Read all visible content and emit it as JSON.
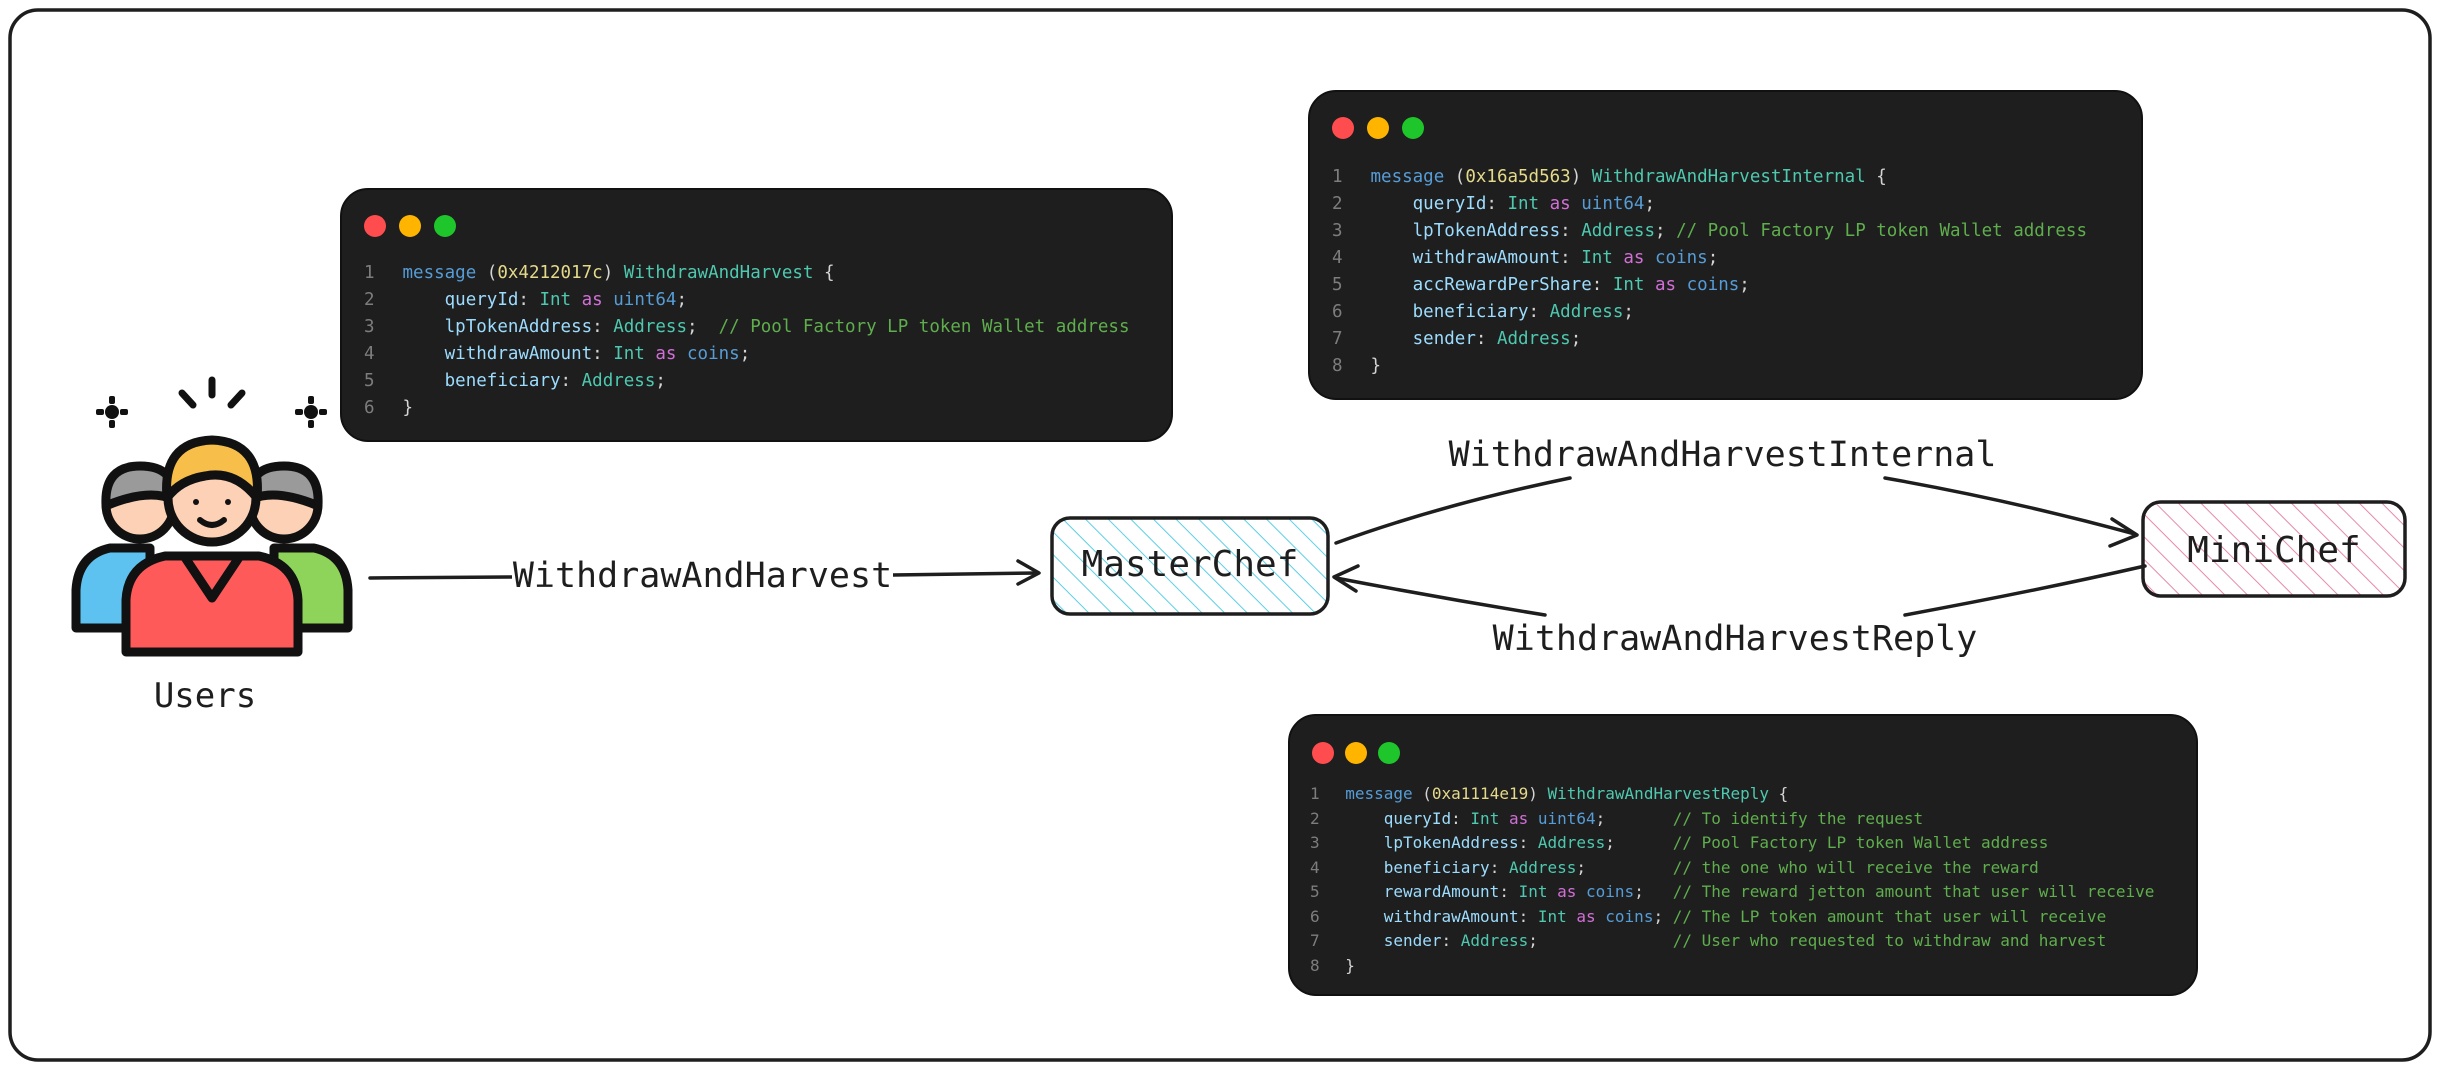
{
  "nodes": {
    "users": "Users",
    "masterchef": "MasterChef",
    "minichef": "MiniChef"
  },
  "edges": {
    "withdraw_and_harvest": "WithdrawAndHarvest",
    "withdraw_and_harvest_internal": "WithdrawAndHarvestInternal",
    "withdraw_and_harvest_reply": "WithdrawAndHarvestReply"
  },
  "colors": {
    "masterchef_hatch": "#5ccfe6",
    "minichef_hatch": "#e88aa8",
    "code_bg": "#1e1e1e"
  },
  "code_blocks": [
    {
      "lines": [
        [
          "1",
          [
            [
              "message",
              "t-kw"
            ],
            [
              " (",
              "t-pun"
            ],
            [
              "0x4212017c",
              "t-num"
            ],
            [
              ") ",
              "t-pun"
            ],
            [
              "WithdrawAndHarvest",
              "t-type"
            ],
            [
              " {",
              "t-pun"
            ]
          ]
        ],
        [
          "2",
          [
            [
              "    queryId",
              "t-field"
            ],
            [
              ": ",
              "t-pun"
            ],
            [
              "Int",
              "t-type"
            ],
            [
              " as ",
              "t-as"
            ],
            [
              "uint64",
              "t-prim"
            ],
            [
              ";",
              "t-pun"
            ]
          ]
        ],
        [
          "3",
          [
            [
              "    lpTokenAddress",
              "t-field"
            ],
            [
              ": ",
              "t-pun"
            ],
            [
              "Address",
              "t-type"
            ],
            [
              ";  ",
              "t-pun"
            ],
            [
              "// Pool Factory LP token Wallet address",
              "t-cmt"
            ]
          ]
        ],
        [
          "4",
          [
            [
              "    withdrawAmount",
              "t-field"
            ],
            [
              ": ",
              "t-pun"
            ],
            [
              "Int",
              "t-type"
            ],
            [
              " as ",
              "t-as"
            ],
            [
              "coins",
              "t-prim"
            ],
            [
              ";",
              "t-pun"
            ]
          ]
        ],
        [
          "5",
          [
            [
              "    beneficiary",
              "t-field"
            ],
            [
              ": ",
              "t-pun"
            ],
            [
              "Address",
              "t-type"
            ],
            [
              ";",
              "t-pun"
            ]
          ]
        ],
        [
          "6",
          [
            [
              "}",
              "t-pun"
            ]
          ]
        ]
      ]
    },
    {
      "lines": [
        [
          "1",
          [
            [
              "message",
              "t-kw"
            ],
            [
              " (",
              "t-pun"
            ],
            [
              "0x16a5d563",
              "t-num"
            ],
            [
              ") ",
              "t-pun"
            ],
            [
              "WithdrawAndHarvestInternal",
              "t-type"
            ],
            [
              " {",
              "t-pun"
            ]
          ]
        ],
        [
          "2",
          [
            [
              "    queryId",
              "t-field"
            ],
            [
              ": ",
              "t-pun"
            ],
            [
              "Int",
              "t-type"
            ],
            [
              " as ",
              "t-as"
            ],
            [
              "uint64",
              "t-prim"
            ],
            [
              ";",
              "t-pun"
            ]
          ]
        ],
        [
          "3",
          [
            [
              "    lpTokenAddress",
              "t-field"
            ],
            [
              ": ",
              "t-pun"
            ],
            [
              "Address",
              "t-type"
            ],
            [
              "; ",
              "t-pun"
            ],
            [
              "// Pool Factory LP token Wallet address",
              "t-cmt"
            ]
          ]
        ],
        [
          "4",
          [
            [
              "    withdrawAmount",
              "t-field"
            ],
            [
              ": ",
              "t-pun"
            ],
            [
              "Int",
              "t-type"
            ],
            [
              " as ",
              "t-as"
            ],
            [
              "coins",
              "t-prim"
            ],
            [
              ";",
              "t-pun"
            ]
          ]
        ],
        [
          "5",
          [
            [
              "    accRewardPerShare",
              "t-field"
            ],
            [
              ": ",
              "t-pun"
            ],
            [
              "Int",
              "t-type"
            ],
            [
              " as ",
              "t-as"
            ],
            [
              "coins",
              "t-prim"
            ],
            [
              ";",
              "t-pun"
            ]
          ]
        ],
        [
          "6",
          [
            [
              "    beneficiary",
              "t-field"
            ],
            [
              ": ",
              "t-pun"
            ],
            [
              "Address",
              "t-type"
            ],
            [
              ";",
              "t-pun"
            ]
          ]
        ],
        [
          "7",
          [
            [
              "    sender",
              "t-field"
            ],
            [
              ": ",
              "t-pun"
            ],
            [
              "Address",
              "t-type"
            ],
            [
              ";",
              "t-pun"
            ]
          ]
        ],
        [
          "8",
          [
            [
              "}",
              "t-pun"
            ]
          ]
        ]
      ]
    },
    {
      "lines": [
        [
          "1",
          [
            [
              "message",
              "t-kw"
            ],
            [
              " (",
              "t-pun"
            ],
            [
              "0xa1114e19",
              "t-num"
            ],
            [
              ") ",
              "t-pun"
            ],
            [
              "WithdrawAndHarvestReply",
              "t-type"
            ],
            [
              " {",
              "t-pun"
            ]
          ]
        ],
        [
          "2",
          [
            [
              "    queryId",
              "t-field"
            ],
            [
              ": ",
              "t-pun"
            ],
            [
              "Int",
              "t-type"
            ],
            [
              " as ",
              "t-as"
            ],
            [
              "uint64",
              "t-prim"
            ],
            [
              ";       ",
              "t-pun"
            ],
            [
              "// To identify the request",
              "t-cmt"
            ]
          ]
        ],
        [
          "3",
          [
            [
              "    lpTokenAddress",
              "t-field"
            ],
            [
              ": ",
              "t-pun"
            ],
            [
              "Address",
              "t-type"
            ],
            [
              ";      ",
              "t-pun"
            ],
            [
              "// Pool Factory LP token Wallet address",
              "t-cmt"
            ]
          ]
        ],
        [
          "4",
          [
            [
              "    beneficiary",
              "t-field"
            ],
            [
              ": ",
              "t-pun"
            ],
            [
              "Address",
              "t-type"
            ],
            [
              ";         ",
              "t-pun"
            ],
            [
              "// the one who will receive the reward",
              "t-cmt"
            ]
          ]
        ],
        [
          "5",
          [
            [
              "    rewardAmount",
              "t-field"
            ],
            [
              ": ",
              "t-pun"
            ],
            [
              "Int",
              "t-type"
            ],
            [
              " as ",
              "t-as"
            ],
            [
              "coins",
              "t-prim"
            ],
            [
              ";   ",
              "t-pun"
            ],
            [
              "// The reward jetton amount that user will receive",
              "t-cmt"
            ]
          ]
        ],
        [
          "6",
          [
            [
              "    withdrawAmount",
              "t-field"
            ],
            [
              ": ",
              "t-pun"
            ],
            [
              "Int",
              "t-type"
            ],
            [
              " as ",
              "t-as"
            ],
            [
              "coins",
              "t-prim"
            ],
            [
              "; ",
              "t-pun"
            ],
            [
              "// The LP token amount that user will receive",
              "t-cmt"
            ]
          ]
        ],
        [
          "7",
          [
            [
              "    sender",
              "t-field"
            ],
            [
              ": ",
              "t-pun"
            ],
            [
              "Address",
              "t-type"
            ],
            [
              ";              ",
              "t-pun"
            ],
            [
              "// User who requested to withdraw and harvest",
              "t-cmt"
            ]
          ]
        ],
        [
          "8",
          [
            [
              "}",
              "t-pun"
            ]
          ]
        ]
      ]
    }
  ]
}
